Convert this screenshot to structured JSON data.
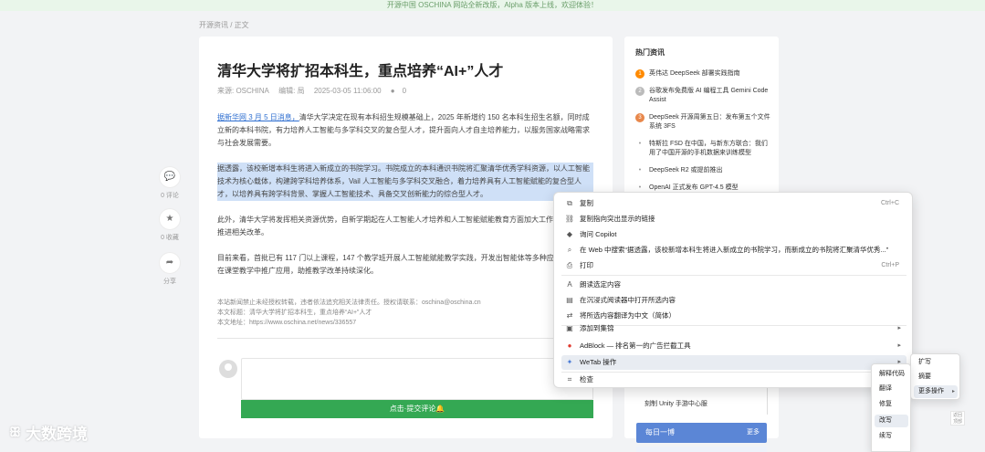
{
  "banner": {
    "text": "开源中国 OSCHINA 网站全新改版，Alpha 版本上线，欢迎体验！"
  },
  "breadcrumb": {
    "text": "开源资讯 / 正文"
  },
  "article": {
    "title": "清华大学将扩招本科生，重点培养“AI+”人才",
    "meta": {
      "source": "来源: OSCHINA",
      "author": "编辑: 局",
      "date": "2025-03-05 11:06:00",
      "comments": "0"
    },
    "p1_lead": "据新华网 3 月 5 日消息，",
    "p1_rest": "清华大学决定在现有本科招生规模基础上，2025 年新增约 150 名本科生招生名额，同时成立新的本科书院，有力培养人工智能与多学科交叉的复合型人才，提升面向人才自主培养能力，以服务国家战略需求与社会发展需要。",
    "p2": "据透露，该校新增本科生将进入新成立的书院学习。书院成立的本科通识书院将汇聚清华优秀学科资源，以人工智能技术为核心载体，构建跨学科培养体系，Vail 人工智能与多学科交叉融合，着力培养具有人工智能赋能的复合型人才，以培养具有跨学科背景、掌握人工智能技术、具备交叉创新能力的综合型人才。",
    "p3": "此外，清华大学将发挥相关资源优势，自新学期起在人工智能人才培养和人工智能赋能教育方面加大工作投入，持续推进相关改革。",
    "p4": "目前来看，首批已有 117 门以上课程，147 个教学班开展人工智能赋能教学实践，开发出智能体等多种应用形式，并在课堂教学中推广应用，助推教学改革持续深化。",
    "footer": [
      "本站新闻禁止未经授权转载，违者依法追究相关法律责任。授权请联系：oschina@oschina.cn",
      "本文标题：清华大学将扩招本科生，重点培养“AI+”人才",
      "本文地址：https://www.oschina.net/news/336557"
    ],
    "submit_label": "点击·提交评论🔔"
  },
  "floaters": [
    {
      "icon": "comment-icon",
      "glyph": "💬",
      "label": "0 评论"
    },
    {
      "icon": "star-icon",
      "glyph": "★",
      "label": "0 收藏"
    },
    {
      "icon": "share-icon",
      "glyph": "➦",
      "label": "分享"
    }
  ],
  "sidebar": {
    "title": "热门资讯",
    "items": [
      {
        "rank": "1",
        "text": "英伟达 DeepSeek 部署实践指南"
      },
      {
        "rank": "2",
        "text": "谷歌发布免费版 AI 编程工具 Gemini Code Assist"
      },
      {
        "rank": "3",
        "text": "DeepSeek 开源周第五日：发布第五个文件系统 3FS"
      },
      {
        "rank": "",
        "text": "特斯拉 FSD 在中国，与新东方联合：我们用了中国开源的手机数据来训练模型"
      },
      {
        "rank": "",
        "text": "DeepSeek R2 或提前推出"
      },
      {
        "rank": "",
        "text": "OpenAI 正式发布 GPT-4.5 模型"
      }
    ],
    "bottom_link": "刻制 Unity 手游中心服",
    "daily_title": "每日一博",
    "daily_tag": "更多"
  },
  "scroll_top_label": "返回顶部",
  "watermark": {
    "text": "大数跨境"
  },
  "context_menu": {
    "items": [
      {
        "icon": "copy-icon",
        "glyph": "⧉",
        "label": "复制",
        "shortcut": "Ctrl+C"
      },
      {
        "icon": "link-icon",
        "glyph": "⛓",
        "label": "复制指向突出显示的链接",
        "shortcut": ""
      },
      {
        "icon": "copilot-icon",
        "glyph": "◆",
        "label": "询问 Copilot",
        "shortcut": ""
      },
      {
        "icon": "search-icon",
        "glyph": "⌕",
        "label": "在 Web 中搜索“据透露，该校新增本科生将进入新成立的书院学习，而新成立的书院将汇聚清华优秀...”",
        "shortcut": ""
      },
      {
        "icon": "print-icon",
        "glyph": "⎙",
        "label": "打印",
        "shortcut": "Ctrl+P"
      },
      {
        "icon": "read-aloud-icon",
        "glyph": "A",
        "label": "朗读选定内容",
        "shortcut": ""
      },
      {
        "icon": "immersive-reader-icon",
        "glyph": "▤",
        "label": "在沉浸式阅读器中打开所选内容",
        "shortcut": ""
      },
      {
        "icon": "translate-icon",
        "glyph": "⇄",
        "label": "将所选内容翻译为中文（简体）",
        "shortcut": ""
      },
      {
        "icon": "collections-icon",
        "glyph": "▣",
        "label": "添加到集锦",
        "shortcut": ""
      },
      {
        "icon": "adblock-icon",
        "glyph": "●",
        "label": "AdBlock — 排名第一的广告拦截工具",
        "shortcut": ""
      },
      {
        "icon": "wetab-icon",
        "glyph": "✦",
        "label": "WeTab 操作",
        "shortcut": ""
      },
      {
        "icon": "inspect-icon",
        "glyph": "⌗",
        "label": "检查",
        "shortcut": ""
      }
    ]
  },
  "submenu1": {
    "items": [
      "扩写",
      "摘要",
      "更多操作"
    ]
  },
  "submenu2": {
    "items": [
      "解释代码",
      "翻译",
      "修复",
      "改写",
      "续写"
    ]
  },
  "colors": {
    "accent_green": "#34a853",
    "selection": "#cfe0f7",
    "link_blue": "#2f6fd0",
    "daily_blue": "#5b86d6"
  }
}
